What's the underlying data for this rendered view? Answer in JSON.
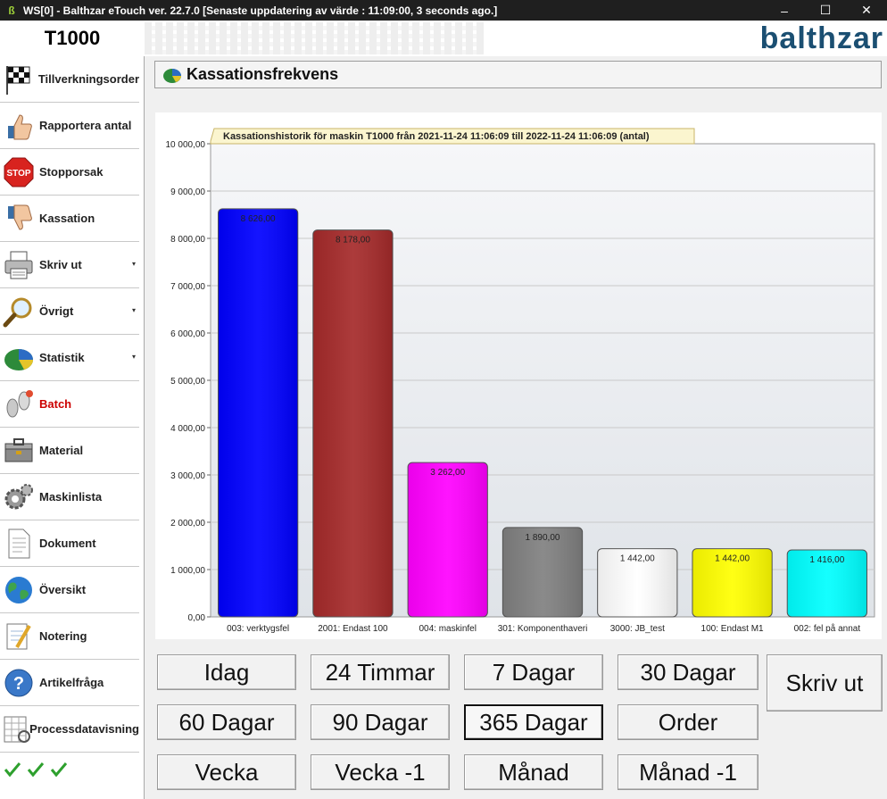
{
  "window": {
    "title": "WS[0] - Balthzar eTouch ver. 22.7.0  [Senaste uppdatering av värde : 11:09:00, 3 seconds ago.]",
    "minimize": "–",
    "maximize": "☐",
    "close": "✕"
  },
  "header": {
    "machine": "T1000",
    "logo": "balthzar"
  },
  "sidebar": {
    "items": [
      {
        "label": "Tillverkningsorder",
        "icon": "checkered-flag-icon"
      },
      {
        "label": "Rapportera antal",
        "icon": "thumbs-up-icon"
      },
      {
        "label": "Stopporsak",
        "icon": "stop-sign-icon"
      },
      {
        "label": "Kassation",
        "icon": "thumbs-down-icon"
      },
      {
        "label": "Skriv ut",
        "icon": "printer-icon",
        "expand": "▾"
      },
      {
        "label": "Övrigt",
        "icon": "magnifier-icon",
        "expand": "▾"
      },
      {
        "label": "Statistik",
        "icon": "statistics-icon",
        "expand": "▾"
      },
      {
        "label": "Batch",
        "icon": "footprints-icon",
        "active": true
      },
      {
        "label": "Material",
        "icon": "toolbox-icon"
      },
      {
        "label": "Maskinlista",
        "icon": "gears-icon"
      },
      {
        "label": "Dokument",
        "icon": "document-icon"
      },
      {
        "label": "Översikt",
        "icon": "globe-icon"
      },
      {
        "label": "Notering",
        "icon": "notepad-icon"
      },
      {
        "label": "Artikelfråga",
        "icon": "question-icon"
      },
      {
        "label": "Processdatavisning",
        "icon": "grid-chart-icon"
      }
    ],
    "status_checks": 3
  },
  "panel": {
    "title": "Kassationsfrekvens"
  },
  "chart_data": {
    "type": "bar",
    "title": "Kassationshistorik för maskin T1000 från 2021-11-24 11:06:09 till 2022-11-24 11:06:09 (antal)",
    "categories": [
      "003: verktygsfel",
      "2001: Endast 100",
      "004: maskinfel",
      "301: Komponenthaveri",
      "3000: JB_test",
      "100: Endast M1",
      "002: fel på annat"
    ],
    "values": [
      8626,
      8178,
      3262,
      1890,
      1442,
      1442,
      1416
    ],
    "value_labels": [
      "8 626,00",
      "8 178,00",
      "3 262,00",
      "1 890,00",
      "1 442,00",
      "1 442,00",
      "1 416,00"
    ],
    "colors": [
      "#0000ff",
      "#a52a2a",
      "#ff00ff",
      "#808080",
      "#ffffff",
      "#ffff00",
      "#00ffff"
    ],
    "ylim": [
      0,
      10000
    ],
    "yticks": [
      0,
      1000,
      2000,
      3000,
      4000,
      5000,
      6000,
      7000,
      8000,
      9000,
      10000
    ],
    "ytick_labels": [
      "0,00",
      "1 000,00",
      "2 000,00",
      "3 000,00",
      "4 000,00",
      "5 000,00",
      "6 000,00",
      "7 000,00",
      "8 000,00",
      "9 000,00",
      "10 000,00"
    ],
    "grid": true,
    "xlabel": "",
    "ylabel": ""
  },
  "buttons": {
    "idag": "Idag",
    "h24": "24 Timmar",
    "d7": "7 Dagar",
    "d30": "30 Dagar",
    "d60": "60 Dagar",
    "d90": "90 Dagar",
    "d365": "365 Dagar",
    "order": "Order",
    "vecka": "Vecka",
    "vecka_prev": "Vecka -1",
    "manad": "Månad",
    "manad_prev": "Månad -1",
    "print": "Skriv ut"
  }
}
